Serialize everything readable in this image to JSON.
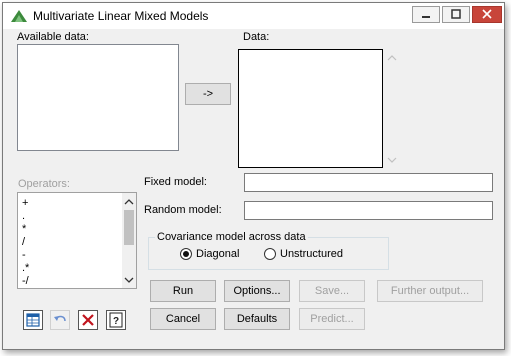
{
  "window": {
    "title": "Multivariate Linear Mixed Models"
  },
  "available_data": {
    "label": "Available data:"
  },
  "transfer_button": {
    "label": "->"
  },
  "data": {
    "label": "Data:"
  },
  "operators": {
    "label": "Operators:",
    "items": [
      "+",
      ".",
      "*",
      "/",
      "-",
      ".*",
      "-/"
    ]
  },
  "fixed_model": {
    "label": "Fixed model:",
    "value": ""
  },
  "random_model": {
    "label": "Random model:",
    "value": ""
  },
  "covariance": {
    "title": "Covariance model across data",
    "options": [
      "Diagonal",
      "Unstructured"
    ],
    "selected": "Diagonal"
  },
  "buttons": {
    "run": "Run",
    "options": "Options...",
    "save": "Save...",
    "further_output": "Further output...",
    "cancel": "Cancel",
    "defaults": "Defaults",
    "predict": "Predict..."
  },
  "colors": {
    "accent": "#3c8a3c",
    "close": "#c8453a"
  }
}
